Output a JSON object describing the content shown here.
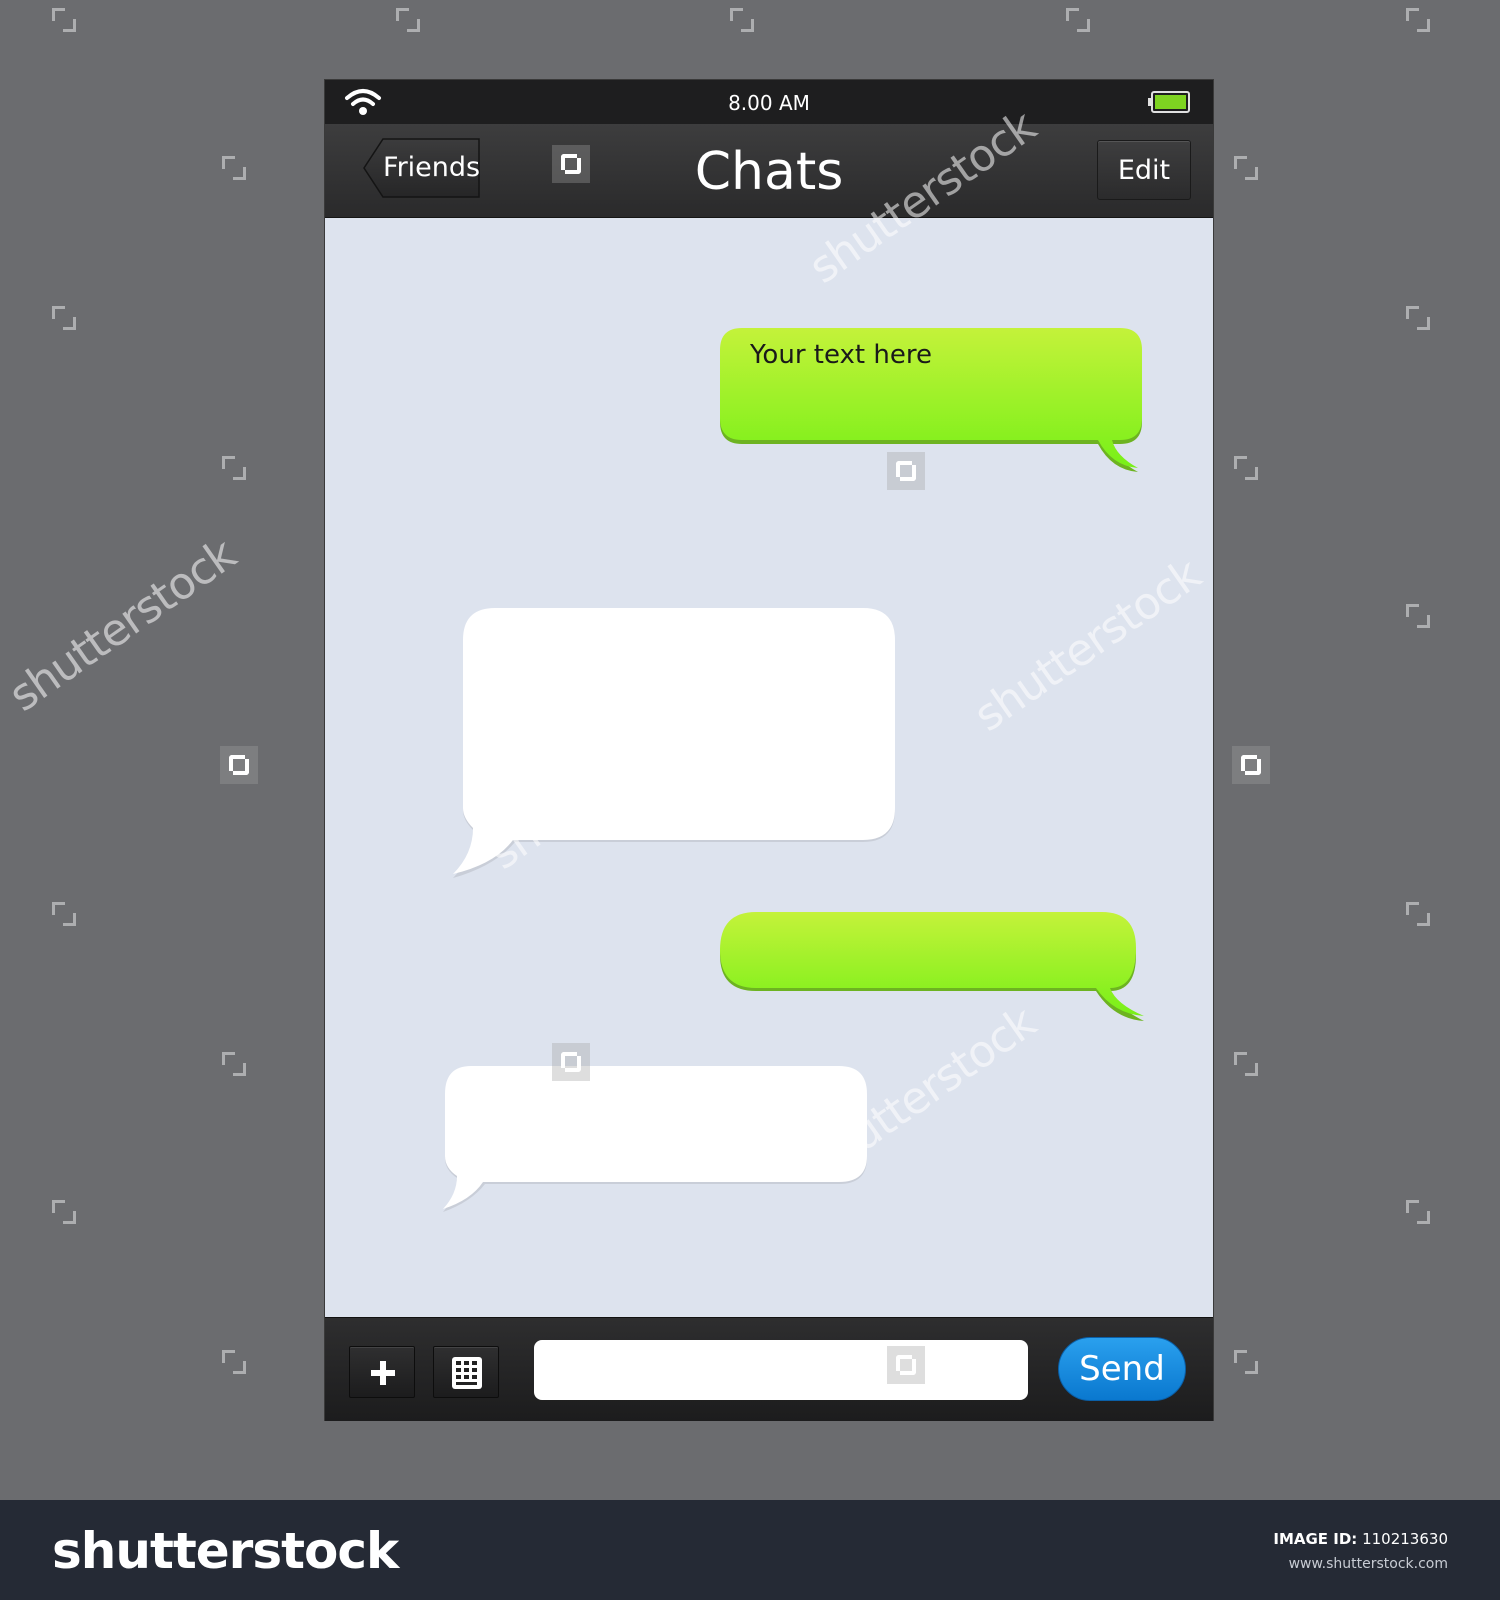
{
  "status_bar": {
    "time": "8.00 AM",
    "wifi_icon": "wifi-icon",
    "battery_icon": "battery-icon",
    "battery_color": "#7ed321"
  },
  "nav_bar": {
    "back_label": "Friends",
    "title": "Chats",
    "edit_label": "Edit"
  },
  "messages": [
    {
      "side": "outgoing",
      "text": "Your text here",
      "color": "#8ee61a"
    },
    {
      "side": "incoming",
      "text": "",
      "color": "#ffffff"
    },
    {
      "side": "outgoing",
      "text": "",
      "color": "#8ee61a"
    },
    {
      "side": "incoming",
      "text": "",
      "color": "#ffffff"
    }
  ],
  "input_bar": {
    "add_icon": "plus-icon",
    "keypad_icon": "keypad-icon",
    "input_value": "",
    "send_label": "Send",
    "send_color": "#1a8be0"
  },
  "watermark": {
    "text": "shutterstock",
    "logo_text": "shutterstock",
    "image_id_label": "IMAGE ID:",
    "image_id": "110213630",
    "site": "www.shutterstock.com"
  }
}
